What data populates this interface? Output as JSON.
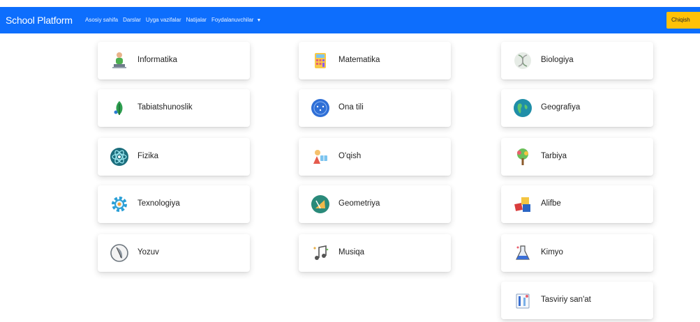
{
  "navbar": {
    "brand": "School Platform",
    "links": [
      "Asosiy sahifa",
      "Darslar",
      "Uyga vazifalar",
      "Natijalar",
      "Foydalanuvchilar"
    ],
    "logout": "Chiqish",
    "colors": {
      "bg": "#0d6efd",
      "logout_bg": "#ffc107"
    }
  },
  "subjects": [
    {
      "label": "Informatika",
      "icon": "laptop-person-icon"
    },
    {
      "label": "Tabiatshunoslik",
      "icon": "leaf-icon"
    },
    {
      "label": "Fizika",
      "icon": "atom-icon"
    },
    {
      "label": "Texnologiya",
      "icon": "gear-icon"
    },
    {
      "label": "Yozuv",
      "icon": "quill-icon"
    },
    {
      "label": "Matematika",
      "icon": "calculator-icon"
    },
    {
      "label": "Ona tili",
      "icon": "globe-letters-icon"
    },
    {
      "label": "O'qish",
      "icon": "reading-child-icon"
    },
    {
      "label": "Geometriya",
      "icon": "compass-icon"
    },
    {
      "label": "Musiqa",
      "icon": "music-notes-icon"
    },
    {
      "label": "Biologiya",
      "icon": "dna-icon"
    },
    {
      "label": "Geografiya",
      "icon": "earth-icon"
    },
    {
      "label": "Tarbiya",
      "icon": "tree-icon"
    },
    {
      "label": "Alifbe",
      "icon": "letter-blocks-icon"
    },
    {
      "label": "Kimyo",
      "icon": "flask-icon"
    },
    {
      "label": "Tasviriy san'at",
      "icon": "paintbrush-icon"
    }
  ]
}
